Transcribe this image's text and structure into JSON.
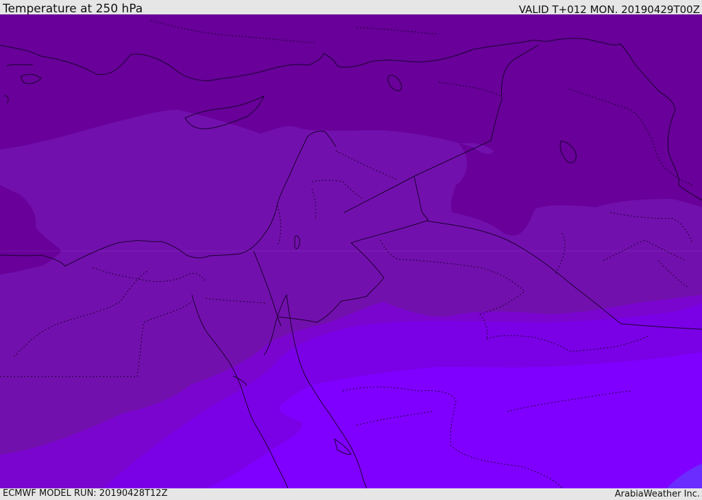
{
  "header": {
    "title": "Temperature at 250 hPa",
    "valid_time": "VALID T+012 MON. 20190429T00Z"
  },
  "footer": {
    "model_run": "ECMWF MODEL RUN: 20190428T12Z",
    "credit": "ArabiaWeather Inc."
  },
  "map": {
    "variable": "temperature",
    "pressure_level": "250 hPa",
    "colors": {
      "band_coldest": "#680099",
      "band_2": "#7210ad",
      "band_3": "#7a05cf",
      "band_4": "#7a00e6",
      "band_warmest": "#8000ff",
      "patch_warm_corner": "#6a2cff",
      "borders": "#1a0030"
    }
  }
}
